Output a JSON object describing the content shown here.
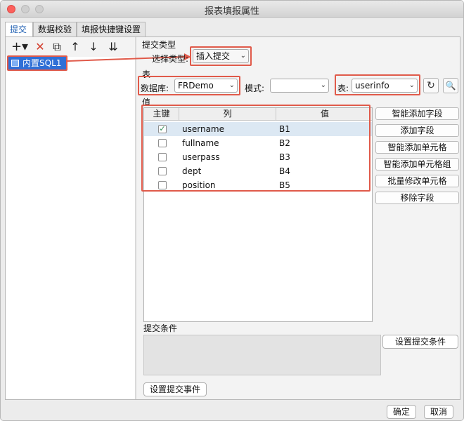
{
  "window": {
    "title": "报表填报属性"
  },
  "tabs": [
    "提交",
    "数据校验",
    "填报快捷键设置"
  ],
  "toolbar": {
    "add": "+▾",
    "delete": "✕",
    "copy": "⧉",
    "up": "↑",
    "down": "↓",
    "import": "⇊"
  },
  "tree": {
    "items": [
      "内置SQL1"
    ]
  },
  "submit_type": {
    "section_label": "提交类型",
    "select_label": "选择类型:",
    "value": "插入提交"
  },
  "table_section": {
    "label": "表",
    "db_label": "数据库:",
    "db_value": "FRDemo",
    "mode_label": "模式:",
    "mode_value": "",
    "table_label": "表:",
    "table_value": "userinfo"
  },
  "values_section": {
    "label": "值"
  },
  "grid": {
    "headers": [
      "主键",
      "列",
      "值"
    ],
    "rows": [
      {
        "key": true,
        "column": "username",
        "value": "B1"
      },
      {
        "key": false,
        "column": "fullname",
        "value": "B2"
      },
      {
        "key": false,
        "column": "userpass",
        "value": "B3"
      },
      {
        "key": false,
        "column": "dept",
        "value": "B4"
      },
      {
        "key": false,
        "column": "position",
        "value": "B5"
      }
    ]
  },
  "side_buttons": [
    "智能添加字段",
    "添加字段",
    "智能添加单元格",
    "智能添加单元格组",
    "批量修改单元格",
    "移除字段"
  ],
  "condition": {
    "label": "提交条件",
    "button": "设置提交条件"
  },
  "event_button": "设置提交事件",
  "footer": {
    "ok": "确定",
    "cancel": "取消"
  },
  "colors": {
    "highlight_red": "#e05a4a",
    "selection_blue": "#2f6fd6"
  }
}
